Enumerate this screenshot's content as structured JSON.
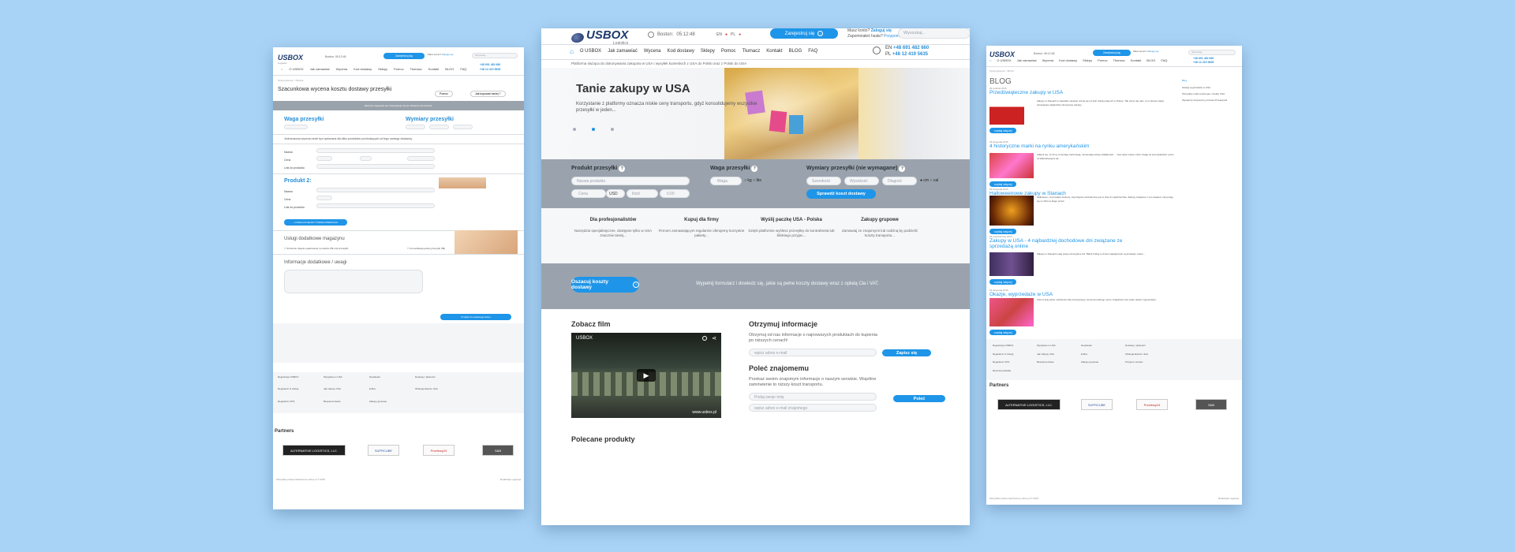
{
  "brand": {
    "name": "USBOX",
    "tagline": "Logistics"
  },
  "header": {
    "clock_label": "Boston:",
    "clock_time": "05:12:48",
    "lang_en": "EN",
    "lang_pl": "PL",
    "register_label": "Zarejestruj się",
    "login_prompt": "Masz konto?",
    "login_link": "Zaloguj się",
    "forgot": "Zapomniałeś hasła?",
    "forgot_link": "Przypomnij",
    "search_placeholder": "Wyszukaj...",
    "phone_en": "+48 691 482 660",
    "phone_pl": "+48 12 419 5635"
  },
  "nav": [
    "O USBOX",
    "Jak zamawiać",
    "Wycena",
    "Kod dostawy",
    "Sklepy",
    "Pomoc",
    "Tłumacz",
    "Kontakt",
    "BLOG",
    "FAQ"
  ],
  "center": {
    "breadcrumb": "Platforma służąca do dokonywania zakupów w USA i wysyłek kurierskich z USA do Polski oraz z Polski do USA",
    "hero_title": "Tanie zakupy w USA",
    "hero_text": "Korzystanie z platformy oznacza niskie ceny transportu, gdyż konsolidujemy wszystkie przesyłki w jeden...",
    "form": {
      "product_label": "Produkt przesyłki",
      "product_placeholder": "Nazwa produktu",
      "price_placeholder": "Cena",
      "currency": "USD",
      "qty_placeholder": "Ilość",
      "value_placeholder": "0.00",
      "weight_label": "Waga przesyłki",
      "weight_placeholder": "Waga",
      "unit_kg": "kg",
      "unit_lbs": "lbs",
      "dims_label": "Wymiary przesyłki (nie wymagane)",
      "width_placeholder": "Szerokość",
      "height_placeholder": "Wysokość",
      "length_placeholder": "Długość",
      "unit_cm": "cm",
      "unit_cal": "cal",
      "check_button": "Sprawdź koszt dostawy"
    },
    "features": [
      {
        "title": "Dla profesjonalistów",
        "text": "Narzędzia specjalistyczne, dostępne tylko w USA znacznie taniej..."
      },
      {
        "title": "Kupuj dla firmy",
        "text": "Firmom zamawiającym regularnie oferujemy korzystne pakiety..."
      },
      {
        "title": "Wyślij paczkę USA - Polska",
        "text": "Dzięki platformie wyślesz przesyłkę do kontrahenta lub bliskiego przyjac..."
      },
      {
        "title": "Zakupy grupowe",
        "text": "Zamawiaj ze znajomymi lub rodziną by podzielić koszty transportu..."
      }
    ],
    "cta_button": "Oszacuj koszty dostawy",
    "cta_text": "Wypełnij formularz i dowiedz się, jakie są pełne koszty dostawy wraz z opłatą Cła i VAT.",
    "film_title": "Zobacz film",
    "video_label": "USBOX",
    "video_url": "www.usbox.pl",
    "info_title": "Otrzymuj informacje",
    "info_text": "Otrzymuj od nas informacje o najnowszych produktach do kupienia po niższych cenach!",
    "email_placeholder": "wpisz adres e-mail",
    "subscribe_button": "Zapisz się",
    "refer_title": "Poleć znajomemu",
    "refer_text": "Przekaż swoim znajomym informacje o naszym serwisie. Wspólne zamówienie to niższy koszt transportu.",
    "name_placeholder": "Podaj swoje imię",
    "friend_email_placeholder": "wpisz adres e-mail znajomego",
    "refer_button": "Poleć",
    "recommended_title": "Polecane produkty"
  },
  "left": {
    "breadcrumb": "Strona główna > Paczka",
    "title": "Szacunkowa wycena kosztu dostawy przesyłki",
    "help_button": "Pomoc",
    "how_button": "Jak kupować taniej ?",
    "notice": "Złożenie zapytania nie zobowiązuje Cię do złożenia zamówienia.",
    "weight_title": "Waga przesyłki",
    "dims_title": "Wymiary przesyłki",
    "note": "Jednorazowa wycena może być wykonana dla kilku produktów pochodzących od tego samego dostawcy.",
    "product1": "Produkt 1:",
    "product2": "Produkt 2:",
    "name_label": "Nazwa",
    "price_label": "Cena",
    "link_label": "Link do produktu",
    "qty_label": "Ilość",
    "value_label": "Wartość",
    "add_button": "+ DODAJ KOLEJNY TOWAR PRZESYŁKI",
    "services_title": "Usługi dodatkowe magazynu",
    "service1": "Zrobienie zdjęcia opakowania / produktu (5$ /zdj.przesyłki)",
    "service2": "Konsolidacja jednej przesyłki (5$)",
    "extra_title": "Informacje dodatkowe / uwagi",
    "next_button": "Przejdź do ostatniego kroku",
    "partners_title": "Partners",
    "copyright": "Wszystkie prawa zastrzeżone usbox.pl © 2015",
    "credits": "Realizacja: agencja"
  },
  "right": {
    "breadcrumb": "Strona główna > BLOG",
    "blog_title": "BLOG",
    "read_more": "czytaj więcej",
    "posts": [
      {
        "date": "06 grudnia 2015",
        "title": "Przedświąteczne zakupy w USA",
        "text": "Zakupy w Stanach w zasadzie niewiele różnią się od tych dokonywanych w Polsce. Tak samo tam jak i tu w okresie świąt obowiązują najbardziej intensywne zakupy..."
      },
      {
        "date": "25 listopada 2015",
        "title": "4 historyczne marki na rynku amerykańskim",
        "text": "Zdarza się, że firmy zmieniają, bankrutują, zamieniają nazwę działalności ... Jest wiele marek, które trwają na amerykańskim rynku od kilkudziesięciu lat..."
      },
      {
        "date": "09 listopada 2015",
        "title": "Halloweenowe zakupy w Stanach",
        "text": "Halloween, czyli święto duchów, zwyczajowo obchodzone jest w dniu 31 października. Zakupy związane z tym świętem zaczynają się w USA na długo przed..."
      },
      {
        "date": "26 października 2015",
        "title": "Zakupy w USA - 4 najbardziej dochodowe dni związane ze sprzedażą online",
        "text": "Zakupy w Stanach mają swoje szczególne dni. Black Friday to dzień największych wyprzedaży online..."
      },
      {
        "date": "06 listopada 2015",
        "title": "Okazje, wyprzedaże w USA",
        "text": "USA to kraj pełne możliwości dla przeciętnego i konsumenckiego rynku. Znajdziesz tam wiele okazji i wyprzedaży..."
      }
    ],
    "sidebar_title": "Blog",
    "sidebar": [
      "Okazje wyprzedaże w USA",
      "Wszystkie marki w Europie i środku USA",
      "Wystarczy bezpieczny przelew Przelewy24"
    ],
    "partners_title": "Partners",
    "copyright": "Wszystkie prawa zastrzeżone usbox.pl © 2015",
    "credits": "Realizacja: agencja"
  },
  "footer_links": [
    "Rejestracja USBOX",
    "Wysyłanie w USA",
    "Newsletter",
    "Dostawy i płatności",
    "Regulamin & Usługi",
    "Jak zakupy USA",
    "E-Box",
    "Obsługa klienta i druk",
    "Regulamin UPS",
    "Bezpieczeństwo",
    "Zakupy grupowe",
    "Przyjmij i zamów",
    "Rezerwuj tabelka"
  ],
  "partners": [
    "ALTERNATIVE LOGISTICS, LLC.",
    "SUPRCUBE",
    "Przelewy24",
    "S&B"
  ]
}
